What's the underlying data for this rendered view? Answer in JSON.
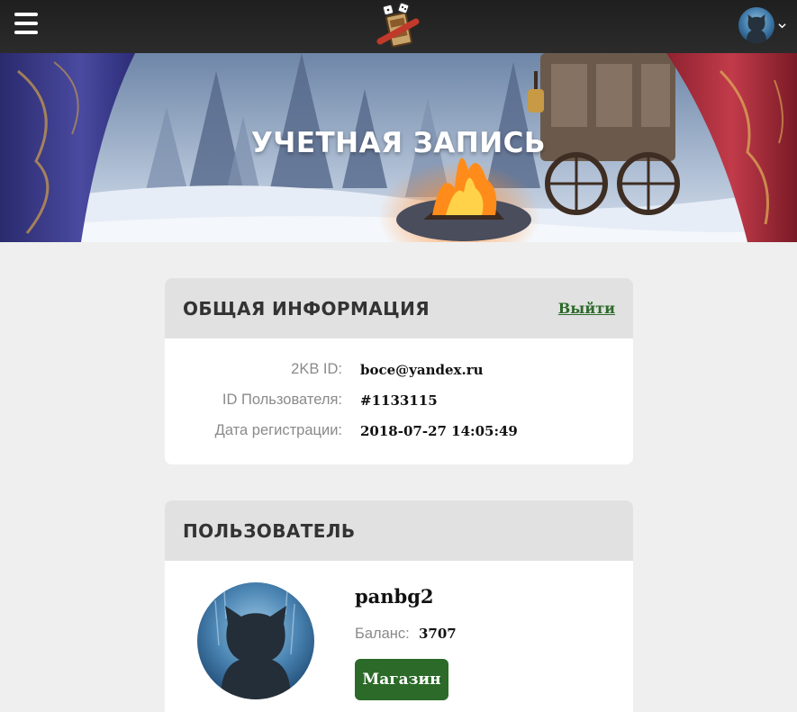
{
  "header": {
    "menu_icon": "hamburger-icon",
    "logo_icon": "game-logo-icon",
    "avatar_icon": "user-avatar-icon",
    "dropdown_icon": "chevron-down-icon"
  },
  "hero": {
    "title": "УЧЕТНАЯ ЗАПИСЬ"
  },
  "general_info": {
    "title": "ОБЩАЯ ИНФОРМАЦИЯ",
    "logout_label": "Выйти",
    "rows": [
      {
        "label": "2KB ID:",
        "value": "boce@yandex.ru"
      },
      {
        "label": "ID Пользователя:",
        "value": "#1133115"
      },
      {
        "label": "Дата регистрации:",
        "value": "2018-07-27 14:05:49"
      }
    ]
  },
  "user": {
    "title": "ПОЛЬЗОВАТЕЛЬ",
    "username": "panbg2",
    "balance_label": "Баланс:",
    "balance_value": "3707",
    "shop_label": "Магазин"
  },
  "colors": {
    "accent_green": "#2b6a28",
    "link_green": "#2d6a2a",
    "topbar": "#222222",
    "page_bg": "#efefef"
  }
}
